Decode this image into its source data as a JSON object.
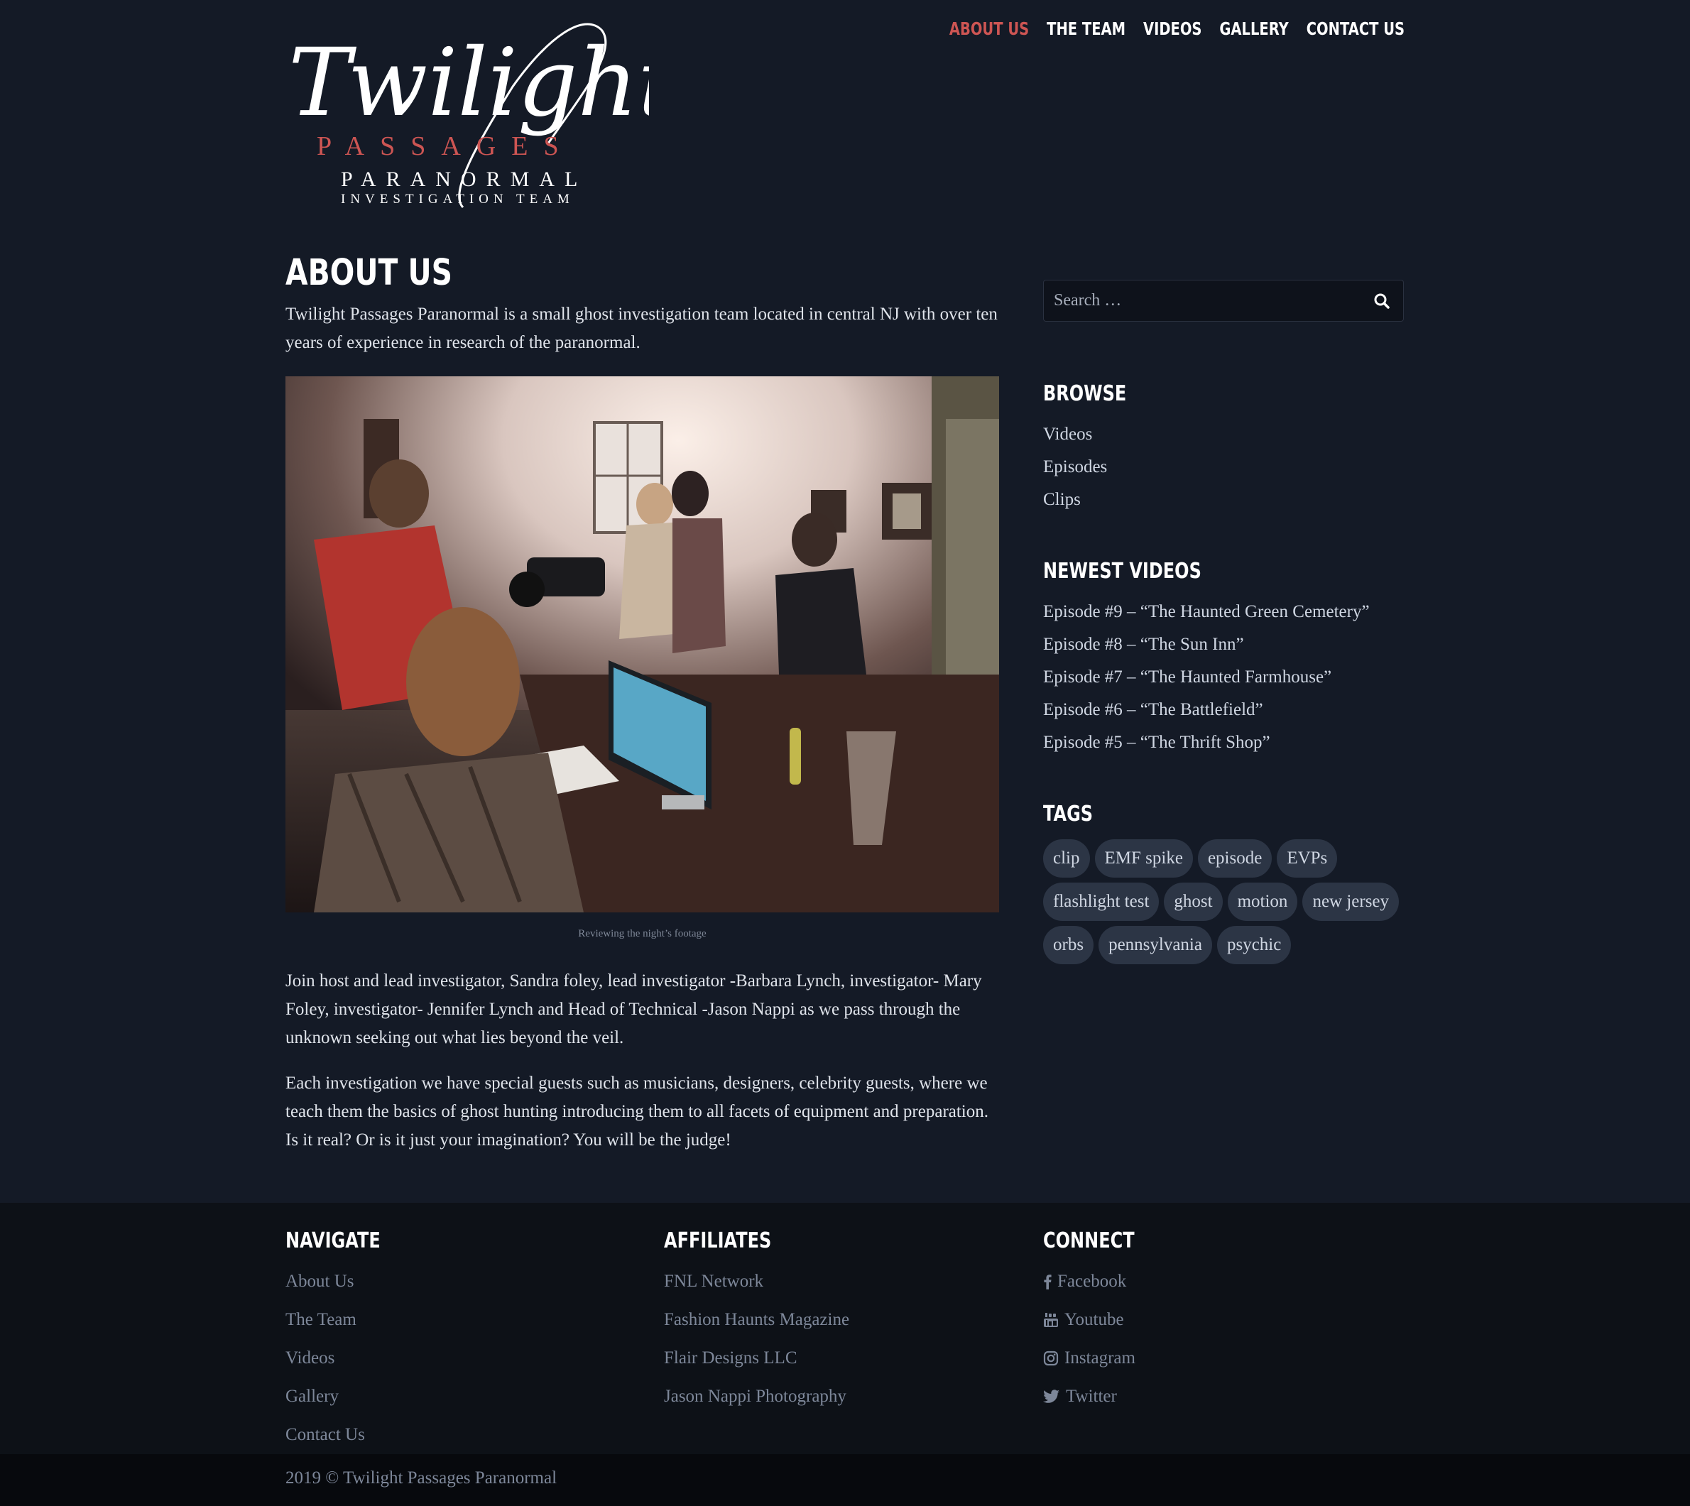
{
  "logo": {
    "script_text": "Twilight",
    "line1": "PASSAGES",
    "line2": "PARANORMAL",
    "line3": "INVESTIGATION TEAM"
  },
  "nav": {
    "items": [
      "About Us",
      "The Team",
      "Videos",
      "Gallery",
      "Contact Us"
    ],
    "active": "About Us"
  },
  "main": {
    "title": "ABOUT US",
    "intro": "Twilight Passages Paranormal is a small ghost investigation team located in central NJ with over ten years of experience in research of the paranormal.",
    "caption": "Reviewing the night’s footage",
    "para1": "Join host and lead investigator, Sandra foley, lead investigator -Barbara Lynch, investigator- Mary Foley, investigator- Jennifer Lynch and Head of Technical -Jason Nappi as we pass through the unknown seeking out what lies beyond the veil.",
    "para2": "Each investigation we have special guests such as musicians, designers, celebrity guests, where we teach them the basics of ghost hunting introducing them to all facets of equipment and preparation.  Is it real? Or is it just your imagination? You will be the judge!"
  },
  "sidebar": {
    "search_placeholder": "Search …",
    "browse_title": "BROWSE",
    "browse": [
      "Videos",
      "Episodes",
      "Clips"
    ],
    "newest_title": "NEWEST VIDEOS",
    "newest": [
      "Episode #9 – “The Haunted Green Cemetery”",
      "Episode #8 – “The Sun Inn”",
      "Episode #7 – “The Haunted Farmhouse”",
      "Episode #6 – “The Battlefield”",
      "Episode #5 – “The Thrift Shop”"
    ],
    "tags_title": "TAGS",
    "tags": [
      "clip",
      "EMF spike",
      "episode",
      "EVPs",
      "flashlight test",
      "ghost",
      "motion",
      "new jersey",
      "orbs",
      "pennsylvania",
      "psychic"
    ]
  },
  "footer": {
    "navigate_title": "NAVIGATE",
    "navigate": [
      "About Us",
      "The Team",
      "Videos",
      "Gallery",
      "Contact Us"
    ],
    "affiliates_title": "AFFILIATES",
    "affiliates": [
      "FNL Network",
      "Fashion Haunts Magazine",
      "Flair Designs LLC",
      "Jason Nappi Photography"
    ],
    "connect_title": "CONNECT",
    "connect": [
      {
        "label": "Facebook",
        "icon": "facebook-icon"
      },
      {
        "label": "Youtube",
        "icon": "youtube-icon"
      },
      {
        "label": "Instagram",
        "icon": "instagram-icon"
      },
      {
        "label": "Twitter",
        "icon": "twitter-icon"
      }
    ],
    "copyright": "2019 © Twilight Passages Paranormal"
  },
  "colors": {
    "background": "#141a26",
    "accent": "#cd5553",
    "footer_bg": "#0d1117",
    "tag_bg": "#2c3545"
  }
}
